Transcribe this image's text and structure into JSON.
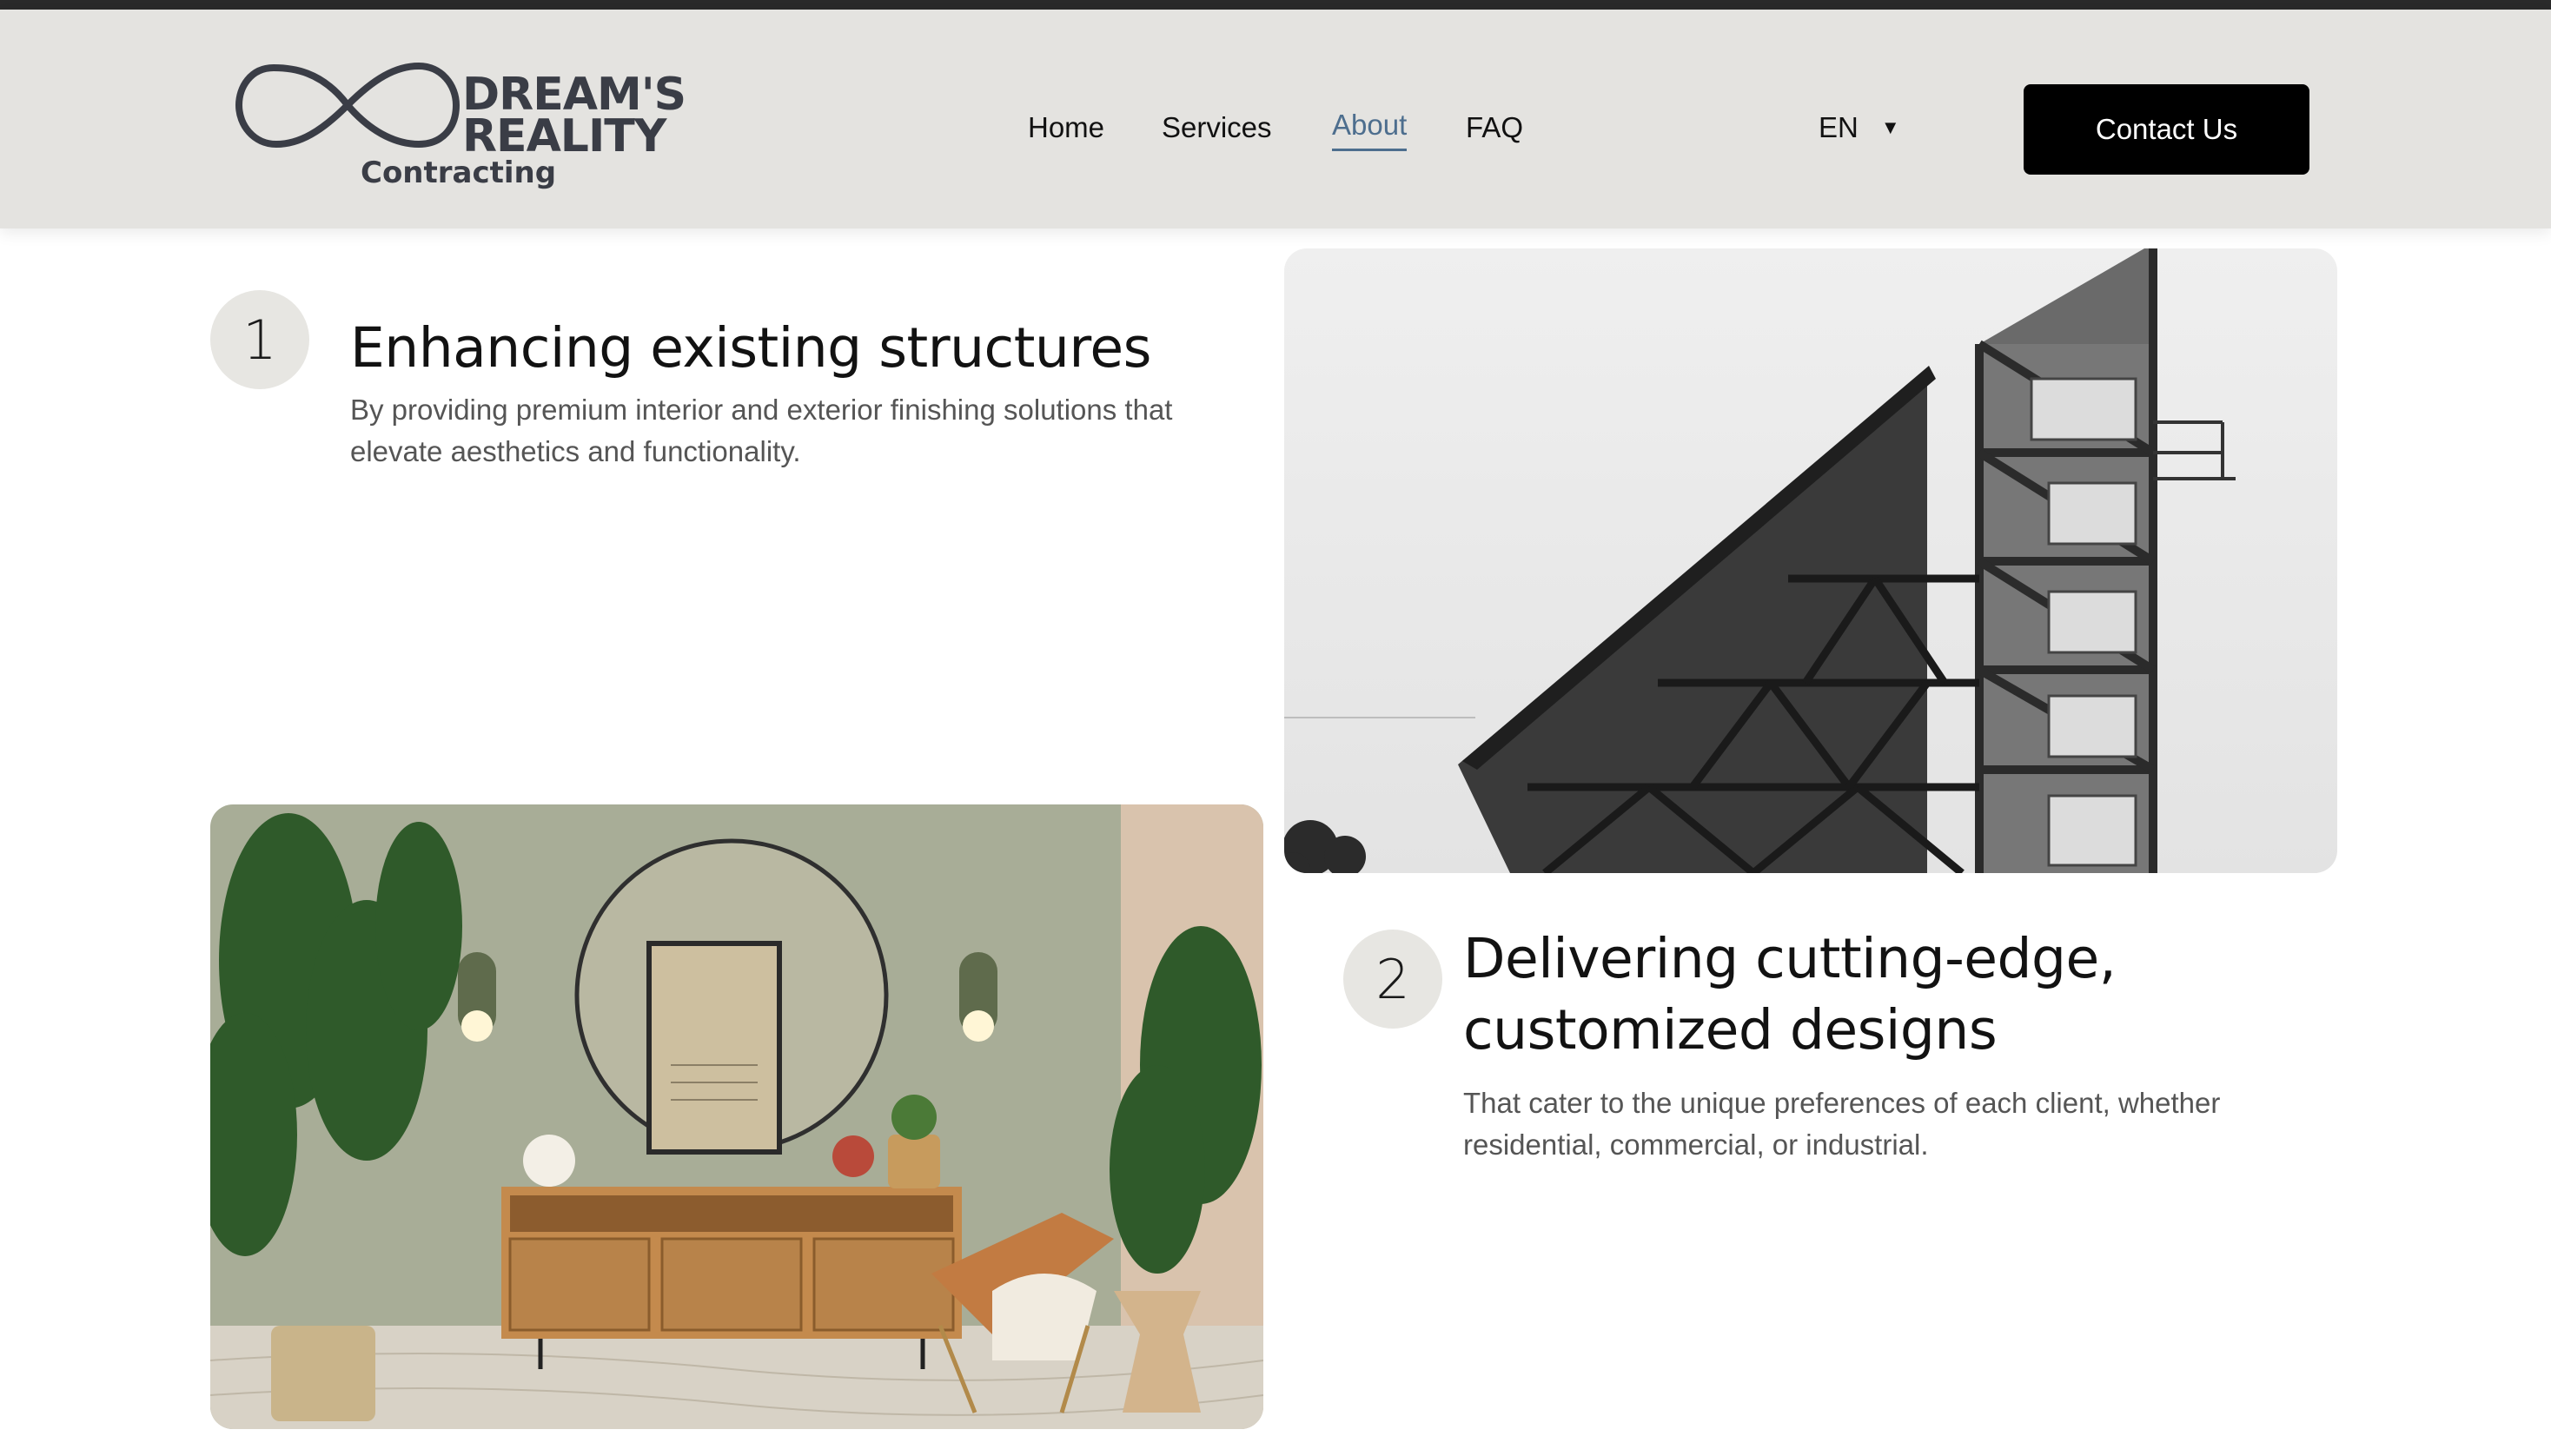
{
  "header": {
    "logo": {
      "line1": "DREAM'S",
      "line2": "REALITY",
      "line3": "Contracting"
    },
    "nav": [
      {
        "label": "Home",
        "active": false
      },
      {
        "label": "Services",
        "active": false
      },
      {
        "label": "About",
        "active": true
      },
      {
        "label": "FAQ",
        "active": false
      }
    ],
    "language": {
      "selected": "EN",
      "icon": "caret-down-icon"
    },
    "cta": "Contact Us"
  },
  "features": [
    {
      "number": "1",
      "title": "Enhancing existing structures",
      "description": "By providing premium interior and exterior finishing solutions that elevate aesthetics and functionality."
    },
    {
      "number": "2",
      "title": "Delivering cutting-edge, customized designs",
      "description": "That cater to the unique preferences of each client, whether residential, commercial, or industrial."
    }
  ],
  "colors": {
    "header_bg": "#e4e3e0",
    "accent_link": "#4d6e8e",
    "button_bg": "#000000"
  }
}
